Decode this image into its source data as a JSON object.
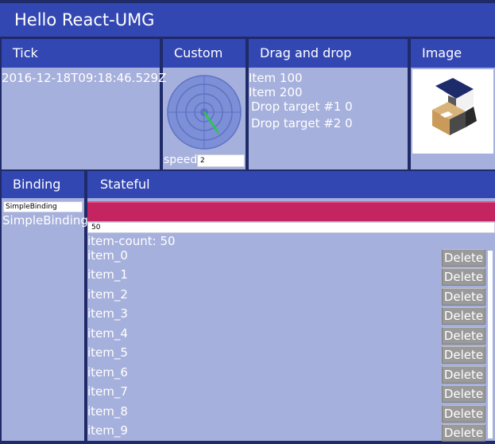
{
  "app": {
    "title": "Hello React-UMG"
  },
  "headers": {
    "tick": "Tick",
    "custom": "Custom",
    "drag_drop": "Drag and drop",
    "image": "Image",
    "binding": "Binding",
    "stateful": "Stateful"
  },
  "tick": {
    "value": "2016-12-18T09:18:46.529Z"
  },
  "custom": {
    "speed_label": "speed",
    "speed_value": "2"
  },
  "drag": {
    "item1": "Item 100",
    "item2": "Item 200",
    "target1": "Drop target #1 0",
    "target2": "Drop target #2 0"
  },
  "binding": {
    "input_value": "SimpleBinding",
    "display": "SimpleBinding"
  },
  "stateful": {
    "count_value": "50",
    "count_label": "item-count: 50",
    "delete_label": "Delete",
    "items": [
      "item_0",
      "item_1",
      "item_2",
      "item_3",
      "item_4",
      "item_5",
      "item_6",
      "item_7",
      "item_8",
      "item_9"
    ]
  },
  "colors": {
    "header_bg": "#3347b3",
    "panel_bg": "#a6b0dc",
    "progress": "#c4245f",
    "delete_button": "#9a9a9a"
  }
}
